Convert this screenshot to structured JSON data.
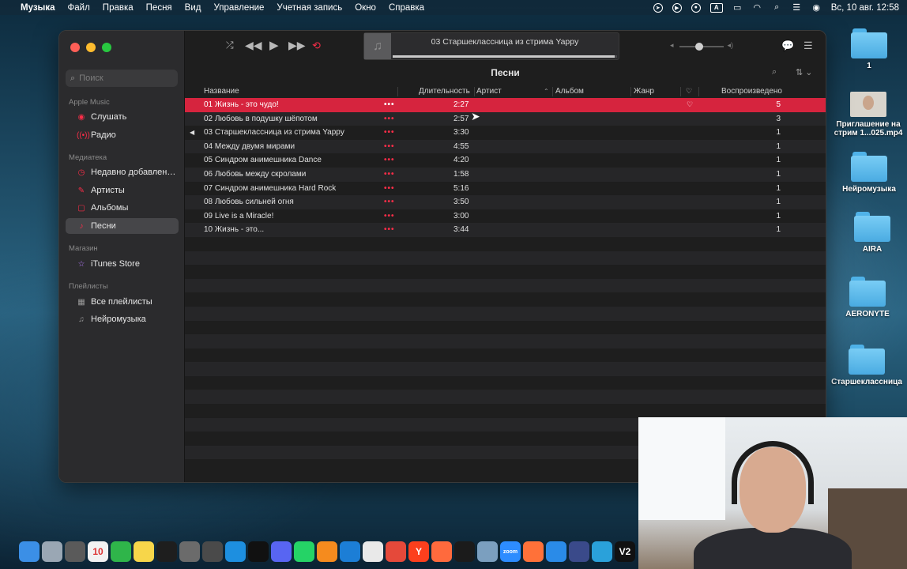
{
  "menubar": {
    "app": "Музыка",
    "items": [
      "Файл",
      "Правка",
      "Песня",
      "Вид",
      "Управление",
      "Учетная запись",
      "Окно",
      "Справка"
    ],
    "clock": "Вс, 10 авг. 12:58",
    "input_source": "A"
  },
  "sidebar": {
    "search_placeholder": "Поиск",
    "sections": {
      "apple_music": "Apple Music",
      "library": "Медиатека",
      "store": "Магазин",
      "playlists": "Плейлисты"
    },
    "items": {
      "listen": "Слушать",
      "radio": "Радио",
      "recently_added": "Недавно добавлен…",
      "artists": "Артисты",
      "albums": "Альбомы",
      "songs": "Песни",
      "itunes_store": "iTunes Store",
      "all_playlists": "Все плейлисты",
      "neuromusic": "Нейромузыка"
    }
  },
  "player": {
    "now_playing": "03 Старшеклассница из стрима Yappy",
    "progress": 0.99,
    "volume": 0.45
  },
  "list": {
    "title": "Песни",
    "columns": {
      "name": "Название",
      "duration": "Длительность",
      "artist": "Артист",
      "album": "Альбом",
      "genre": "Жанр",
      "plays": "Воспроизведено"
    },
    "songs": [
      {
        "title": "01 Жизнь - это чудо!",
        "duration": "2:27",
        "plays": "5",
        "loved": true,
        "selected": true
      },
      {
        "title": "02 Любовь в подушку шёпотом",
        "duration": "2:57",
        "plays": "3"
      },
      {
        "title": "03 Старшеклассница из стрима Yappy",
        "duration": "3:30",
        "plays": "1",
        "playing": true
      },
      {
        "title": "04 Между двумя мирами",
        "duration": "4:55",
        "plays": "1"
      },
      {
        "title": "05 Синдром анимешника Dance",
        "duration": "4:20",
        "plays": "1"
      },
      {
        "title": "06 Любовь между скролами",
        "duration": "1:58",
        "plays": "1"
      },
      {
        "title": "07 Синдром анимешника Hard Rock",
        "duration": "5:16",
        "plays": "1"
      },
      {
        "title": "08 Любовь сильней огня",
        "duration": "3:50",
        "plays": "1"
      },
      {
        "title": "09 Live is a Miracle!",
        "duration": "3:00",
        "plays": "1"
      },
      {
        "title": "10 Жизнь - это...",
        "duration": "3:44",
        "plays": "1"
      }
    ],
    "more_glyph": "•••",
    "heart_glyph": "♡",
    "playing_glyph": "◀"
  },
  "desktop": {
    "items": [
      {
        "label": "1",
        "kind": "folder"
      },
      {
        "label": "Приглашение на стрим 1...025.mp4",
        "kind": "video"
      },
      {
        "label": "Нейромузыка",
        "kind": "folder"
      },
      {
        "label": "AIRA",
        "kind": "folder"
      },
      {
        "label": "AERONYTE",
        "kind": "folder"
      },
      {
        "label": "Старшеклассница",
        "kind": "folder"
      }
    ]
  },
  "dock": {
    "apps": [
      {
        "name": "finder",
        "color": "#3b8fe6"
      },
      {
        "name": "launchpad",
        "color": "#9aa7b4"
      },
      {
        "name": "calculator",
        "color": "#5a5a5a"
      },
      {
        "name": "calendar",
        "color": "#f2f2f2",
        "label": "10"
      },
      {
        "name": "numbers",
        "color": "#2fb54a"
      },
      {
        "name": "notes",
        "color": "#f7d64a"
      },
      {
        "name": "figma",
        "color": "#1e1e1e"
      },
      {
        "name": "automator",
        "color": "#6b6b6b"
      },
      {
        "name": "activity",
        "color": "#4a4a4a"
      },
      {
        "name": "docker",
        "color": "#1d8fe0"
      },
      {
        "name": "capcut",
        "color": "#111111"
      },
      {
        "name": "discord",
        "color": "#5865f2"
      },
      {
        "name": "whatsapp",
        "color": "#25d366"
      },
      {
        "name": "sublime",
        "color": "#f58b1e"
      },
      {
        "name": "vscode",
        "color": "#1c7ed6"
      },
      {
        "name": "textedit",
        "color": "#e9e9e9"
      },
      {
        "name": "chrome",
        "color": "#e5493a"
      },
      {
        "name": "yandex",
        "color": "#fc3f1d",
        "label": "Y"
      },
      {
        "name": "pen",
        "color": "#ff6a3d"
      },
      {
        "name": "terminal",
        "color": "#1b1b1b"
      },
      {
        "name": "preview",
        "color": "#7b9fbf"
      },
      {
        "name": "zoom",
        "color": "#2d8cff",
        "label": "zoom"
      },
      {
        "name": "firefox",
        "color": "#ff7139"
      },
      {
        "name": "safari",
        "color": "#2a8be8"
      },
      {
        "name": "unknown",
        "color": "#3a4a8a"
      },
      {
        "name": "telegram",
        "color": "#2aa1da"
      },
      {
        "name": "v2",
        "color": "#111111",
        "label": "V2"
      }
    ]
  }
}
